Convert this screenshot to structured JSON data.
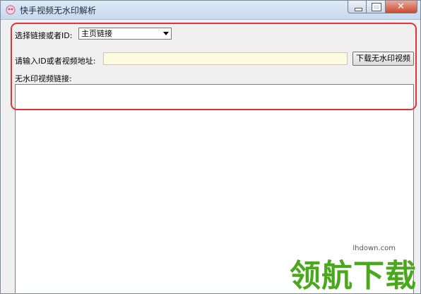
{
  "window": {
    "title": "快手视频无水印解析",
    "close_glyph": "✕"
  },
  "form": {
    "link_type_label": "选择链接或者ID:",
    "link_type_selected": "主页链接",
    "url_label": "请输入ID或者视频地址:",
    "url_value": "",
    "download_button": "下载无水印视频",
    "output_label": "无水印视频链接:",
    "output_value": ""
  },
  "watermark": {
    "site": "lhdown.com",
    "text": "领航下载",
    "color": "#4aa81d"
  },
  "colors": {
    "highlight_border": "#e0333a",
    "input_background": "#fdfbe2"
  }
}
